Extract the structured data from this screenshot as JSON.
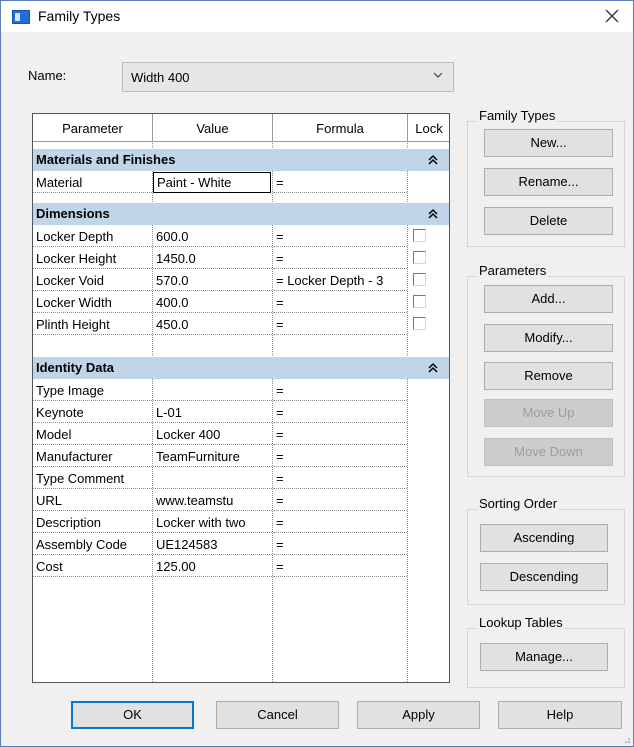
{
  "window": {
    "title": "Family Types"
  },
  "name_field": {
    "label": "Name:",
    "value": "Width 400"
  },
  "table": {
    "headers": {
      "parameter": "Parameter",
      "value": "Value",
      "formula": "Formula",
      "lock": "Lock"
    },
    "groups": {
      "materials": {
        "title": "Materials and Finishes"
      },
      "dimensions": {
        "title": "Dimensions"
      },
      "identity": {
        "title": "Identity Data"
      }
    },
    "rows": [
      {
        "param": "Material",
        "value": "Paint - White",
        "formula": "="
      },
      {
        "param": "Locker Depth",
        "value": "600.0",
        "formula": "="
      },
      {
        "param": "Locker Height",
        "value": "1450.0",
        "formula": "="
      },
      {
        "param": "Locker Void",
        "value": "570.0",
        "formula": "= Locker Depth - 3"
      },
      {
        "param": "Locker Width",
        "value": "400.0",
        "formula": "="
      },
      {
        "param": "Plinth Height",
        "value": "450.0",
        "formula": "="
      },
      {
        "param": "Type Image",
        "value": "",
        "formula": "="
      },
      {
        "param": "Keynote",
        "value": "L-01",
        "formula": "="
      },
      {
        "param": "Model",
        "value": "Locker 400",
        "formula": "="
      },
      {
        "param": "Manufacturer",
        "value": "TeamFurniture",
        "formula": "="
      },
      {
        "param": "Type Comment",
        "value": "",
        "formula": "="
      },
      {
        "param": "URL",
        "value": "www.teamstu",
        "formula": "="
      },
      {
        "param": "Description",
        "value": "Locker with two",
        "formula": "="
      },
      {
        "param": "Assembly Code",
        "value": "UE124583",
        "formula": "="
      },
      {
        "param": "Cost",
        "value": "125.00",
        "formula": "="
      }
    ]
  },
  "family_types_box": {
    "title": "Family Types",
    "new": "New...",
    "rename": "Rename...",
    "delete": "Delete"
  },
  "parameters_box": {
    "title": "Parameters",
    "add": "Add...",
    "modify": "Modify...",
    "remove": "Remove",
    "move_up": "Move Up",
    "move_down": "Move Down"
  },
  "sorting_box": {
    "title": "Sorting Order",
    "ascending": "Ascending",
    "descending": "Descending"
  },
  "lookup_box": {
    "title": "Lookup Tables",
    "manage": "Manage..."
  },
  "footer": {
    "ok": "OK",
    "cancel": "Cancel",
    "apply": "Apply",
    "help": "Help"
  },
  "icons": {
    "close": "close-icon",
    "dropdown": "chevron-down-icon",
    "collapse": "double-chevron-up-icon",
    "window": "window-icon"
  },
  "colors": {
    "group_header": "#c1d5e8",
    "default_button_border": "#0078d7",
    "window_border": "#5b7fb5"
  }
}
